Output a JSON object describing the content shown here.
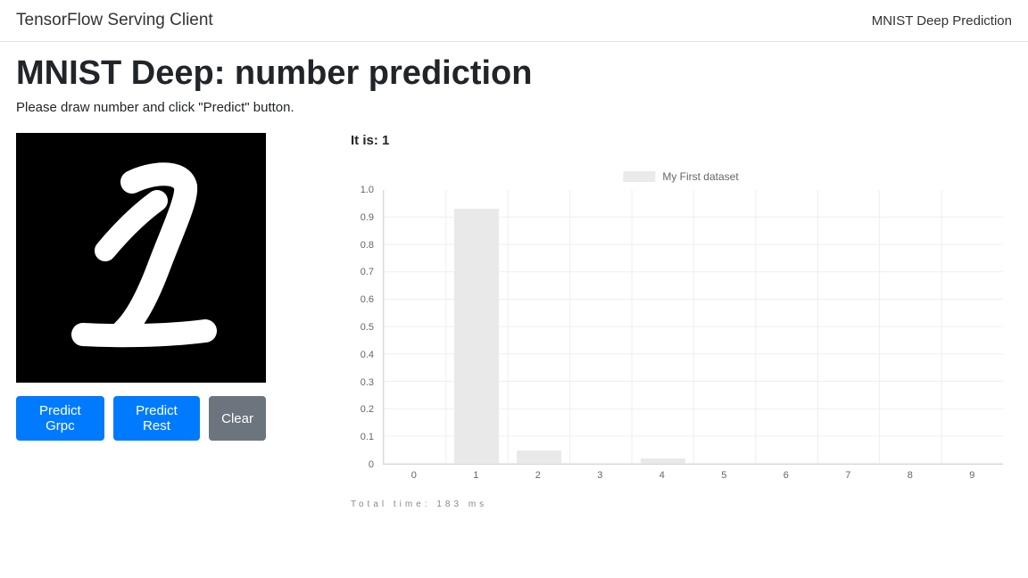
{
  "navbar": {
    "brand": "TensorFlow Serving Client",
    "right": "MNIST Deep Prediction"
  },
  "header": {
    "title": "MNIST Deep: number prediction",
    "subtitle": "Please draw number and click \"Predict\" button."
  },
  "buttons": {
    "grpc": "Predict Grpc",
    "rest": "Predict Rest",
    "clear": "Clear"
  },
  "result": {
    "label_prefix": "It is: ",
    "value": "1"
  },
  "chart_data": {
    "type": "bar",
    "legend": "My First dataset",
    "categories": [
      "0",
      "1",
      "2",
      "3",
      "4",
      "5",
      "6",
      "7",
      "8",
      "9"
    ],
    "values": [
      0.0,
      0.93,
      0.05,
      0.0,
      0.02,
      0.0,
      0.0,
      0.0,
      0.0,
      0.0
    ],
    "bar_color": "#e9e9e9",
    "ylim": [
      0,
      1.0
    ],
    "yticks": [
      "0",
      "0.1",
      "0.2",
      "0.3",
      "0.4",
      "0.5",
      "0.6",
      "0.7",
      "0.8",
      "0.9",
      "1.0"
    ]
  },
  "timing": "Total time: 183 ms"
}
